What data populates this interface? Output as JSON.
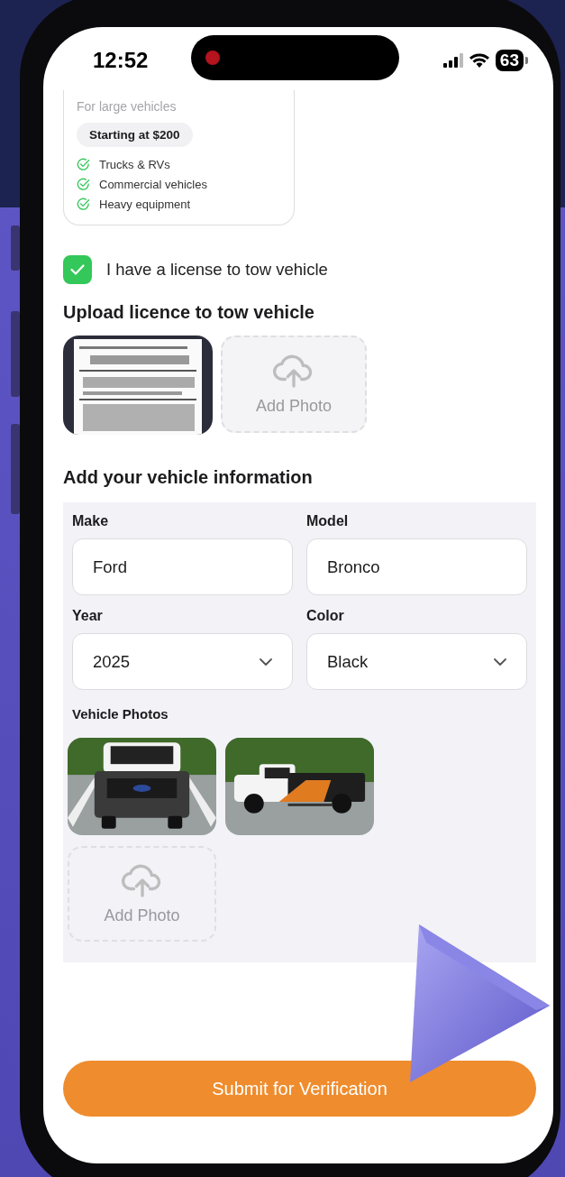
{
  "status_bar": {
    "time": "12:52",
    "battery": "63"
  },
  "plan_card": {
    "subtitle": "For large vehicles",
    "price": "Starting at $200",
    "features": [
      "Trucks & RVs",
      "Commercial vehicles",
      "Heavy equipment"
    ]
  },
  "license_checkbox": {
    "label": "I have a license to tow vehicle",
    "checked": true
  },
  "license_upload": {
    "title": "Upload licence to tow vehicle",
    "add_label": "Add Photo"
  },
  "vehicle": {
    "title": "Add your vehicle information",
    "fields": [
      {
        "label": "Make",
        "value": "Ford",
        "kind": "text"
      },
      {
        "label": "Model",
        "value": "Bronco",
        "kind": "text"
      },
      {
        "label": "Year",
        "value": "2025",
        "kind": "select"
      },
      {
        "label": "Color",
        "value": "Black",
        "kind": "select"
      }
    ],
    "photos_label": "Vehicle Photos",
    "add_label": "Add Photo"
  },
  "submit": "Submit for Verification"
}
